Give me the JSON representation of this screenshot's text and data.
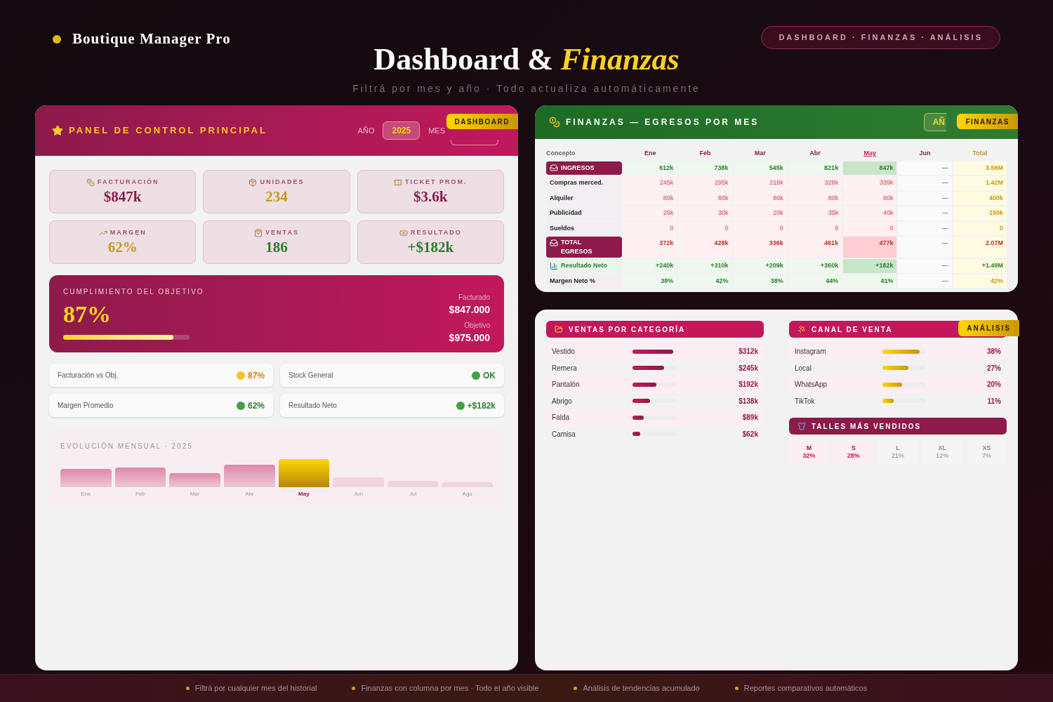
{
  "brand": {
    "name": "Boutique Manager Pro"
  },
  "title": "Dashboard & *Finanzas*",
  "subtitle": "Filtrá por mes y año · Todo actualiza automáticamente",
  "nav_pill": "DASHBOARD · FINANZAS · ANÁLISIS",
  "control_panel": {
    "title": "PANEL DE CONTROL PRINCIPAL",
    "year_label": "AÑO",
    "year": "2025",
    "month_label": "MES",
    "tag": "DASHBOARD",
    "kpis": [
      {
        "label": "FACTURACIÓN",
        "value": "$847k"
      },
      {
        "label": "UNIDADES",
        "value": "234"
      },
      {
        "label": "TICKET PROM.",
        "value": "$3.6k"
      },
      {
        "label": "MARGEN",
        "value": "62%"
      },
      {
        "label": "VENTAS",
        "value": "186"
      },
      {
        "label": "RESULTADO",
        "value": "+$182k"
      }
    ],
    "goal": {
      "title": "CUMPLIMIENTO DEL OBJETIVO",
      "percent": "87%",
      "level": 0.87,
      "billed_label": "Facturado",
      "billed": "$847.000",
      "target_label": "Objetivo",
      "target": "$975.000"
    },
    "status": [
      {
        "label": "Facturación vs Obj.",
        "value": "87%",
        "color": "#fbc02d"
      },
      {
        "label": "Stock General",
        "value": "OK",
        "color": "#43a047"
      },
      {
        "label": "Margen Promedio",
        "value": "62%",
        "color": "#43a047"
      },
      {
        "label": "Resultado Neto",
        "value": "+$182k",
        "color": "#43a047"
      }
    ],
    "monthly": {
      "title": "EVOLUCIÓN MENSUAL · 2025",
      "months": [
        {
          "label": "Ene",
          "selected": false
        },
        {
          "label": "Feb",
          "selected": false
        },
        {
          "label": "Mar",
          "selected": false
        },
        {
          "label": "Abr",
          "selected": false
        },
        {
          "label": "May",
          "selected": true
        },
        {
          "label": "Jun",
          "selected": false
        },
        {
          "label": "Jul",
          "selected": false
        },
        {
          "label": "Ago",
          "selected": false
        }
      ]
    }
  },
  "finance": {
    "title": "FINANZAS — EGRESOS POR MES",
    "year_field": "AÑ",
    "tag": "FINANZAS",
    "columns": [
      {
        "label": "Concepto",
        "selected": false
      },
      {
        "label": "Ene",
        "selected": false
      },
      {
        "label": "Feb",
        "selected": false
      },
      {
        "label": "Mar",
        "selected": false
      },
      {
        "label": "Abr",
        "selected": false
      },
      {
        "label": "May",
        "selected": true
      },
      {
        "label": "Jun",
        "selected": false
      },
      {
        "label": "Total",
        "selected": false
      }
    ],
    "rows": [
      {
        "kind": "income",
        "label": "INGRESOS",
        "cells": [
          "612k",
          "738k",
          "545k",
          "821k",
          "847k",
          "—",
          "3.56M"
        ]
      },
      {
        "kind": "expense",
        "label": "Compras merced.",
        "cells": [
          "245k",
          "295k",
          "218k",
          "328k",
          "339k",
          "—",
          "1.42M"
        ]
      },
      {
        "kind": "expense",
        "label": "Alquiler",
        "cells": [
          "80k",
          "80k",
          "80k",
          "80k",
          "80k",
          "—",
          "400k"
        ]
      },
      {
        "kind": "expense",
        "label": "Publicidad",
        "cells": [
          "25k",
          "30k",
          "20k",
          "35k",
          "40k",
          "—",
          "150k"
        ]
      },
      {
        "kind": "expense",
        "label": "Sueldos",
        "cells": [
          "0",
          "0",
          "0",
          "0",
          "0",
          "—",
          "0"
        ]
      },
      {
        "kind": "total",
        "label": "TOTAL EGRESOS",
        "cells": [
          "372k",
          "428k",
          "336k",
          "461k",
          "477k",
          "—",
          "2.07M"
        ]
      },
      {
        "kind": "result",
        "label": "Resultado Neto",
        "cells": [
          "+240k",
          "+310k",
          "+209k",
          "+360k",
          "+182k",
          "—",
          "+1.49M"
        ]
      },
      {
        "kind": "margin",
        "label": "Margen Neto %",
        "cells": [
          "39%",
          "42%",
          "38%",
          "44%",
          "41%",
          "—",
          "42%"
        ]
      }
    ]
  },
  "categories": {
    "title": "VENTAS POR CATEGORÍA",
    "items": [
      {
        "name": "Vestido",
        "level": 0.93,
        "value": "$312k"
      },
      {
        "name": "Remera",
        "level": 0.72,
        "value": "$245k"
      },
      {
        "name": "Pantalón",
        "level": 0.55,
        "value": "$192k"
      },
      {
        "name": "Abrigo",
        "level": 0.4,
        "value": "$138k"
      },
      {
        "name": "Falda",
        "level": 0.26,
        "value": "$89k"
      },
      {
        "name": "Camisa",
        "level": 0.18,
        "value": "$62k"
      }
    ]
  },
  "channels": {
    "title": "CANAL DE VENTA",
    "tag": "ANÁLISIS",
    "items": [
      {
        "name": "Instagram",
        "level": 0.85,
        "value": "38%"
      },
      {
        "name": "Local",
        "level": 0.6,
        "value": "27%"
      },
      {
        "name": "WhatsApp",
        "level": 0.45,
        "value": "20%"
      },
      {
        "name": "TikTok",
        "level": 0.25,
        "value": "11%"
      }
    ]
  },
  "sizes": {
    "title": "TALLES MÁS VENDIDOS",
    "items": [
      {
        "size": "M",
        "share": "32%",
        "highlighted": true
      },
      {
        "size": "S",
        "share": "28%",
        "highlighted": true
      },
      {
        "size": "L",
        "share": "21%",
        "highlighted": false
      },
      {
        "size": "XL",
        "share": "12%",
        "highlighted": false
      },
      {
        "size": "XS",
        "share": "7%",
        "highlighted": false
      }
    ]
  },
  "footer": [
    "Filtrá por cualquier mes del historial",
    "Finanzas con columna por mes · Todo el año visible",
    "Análisis de tendencias acumulado",
    "Reportes comparativos automáticos"
  ]
}
